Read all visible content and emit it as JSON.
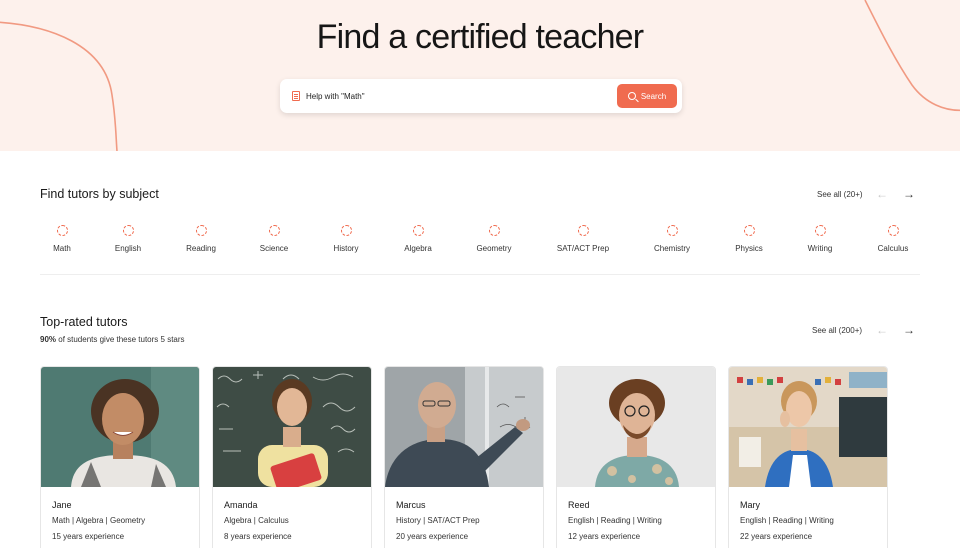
{
  "hero": {
    "title": "Find a certified teacher",
    "search_placeholder": "Help with \"Math\"",
    "search_button": "Search"
  },
  "subjects_section": {
    "title": "Find tutors by subject",
    "see_all": "See all (20+)",
    "items": [
      {
        "label": "Math"
      },
      {
        "label": "English"
      },
      {
        "label": "Reading"
      },
      {
        "label": "Science"
      },
      {
        "label": "History"
      },
      {
        "label": "Algebra"
      },
      {
        "label": "Geometry"
      },
      {
        "label": "SAT/ACT Prep"
      },
      {
        "label": "Chemistry"
      },
      {
        "label": "Physics"
      },
      {
        "label": "Writing"
      },
      {
        "label": "Calculus"
      }
    ]
  },
  "tutors_section": {
    "title": "Top-rated tutors",
    "subtitle_bold": "90%",
    "subtitle_rest": " of students give these tutors 5 stars",
    "see_all": "See all (200+)",
    "tutors": [
      {
        "name": "Jane",
        "subjects": "Math | Algebra | Geometry",
        "experience": "15 years experience"
      },
      {
        "name": "Amanda",
        "subjects": "Algebra | Calculus",
        "experience": "8 years experience"
      },
      {
        "name": "Marcus",
        "subjects": "History | SAT/ACT Prep",
        "experience": "20 years experience"
      },
      {
        "name": "Reed",
        "subjects": "English | Reading | Writing",
        "experience": "12 years experience"
      },
      {
        "name": "Mary",
        "subjects": "English | Reading | Writing",
        "experience": "22 years experience"
      }
    ]
  },
  "colors": {
    "accent": "#f06b4f",
    "hero_bg": "#fdf1ec"
  },
  "icons": {
    "search_field": "document-icon",
    "search_button": "search-icon",
    "subject": "dashed-circle-icon",
    "prev": "arrow-left-icon",
    "next": "arrow-right-icon"
  }
}
